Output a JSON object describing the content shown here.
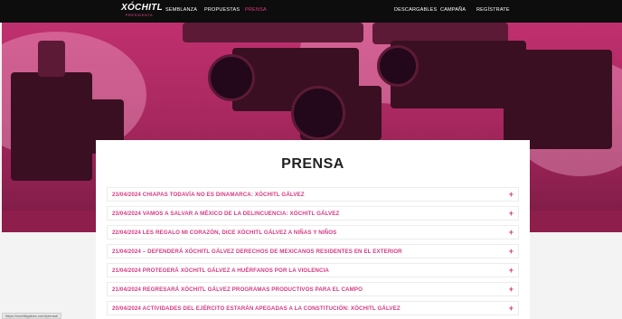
{
  "nav": {
    "logo_main": "XÓCHITL",
    "logo_sub": "PRESIDENTA",
    "left_items": [
      "SEMBLANZA",
      "PROPUESTAS",
      "PRENSA"
    ],
    "right_items": [
      "DESCARGABLES",
      "CAMPAÑA",
      "REGÍSTRATE"
    ],
    "active": "PRENSA"
  },
  "main": {
    "title": "PRENSA",
    "items": [
      "23/04/2024 CHIAPAS TODAVÍA NO ES DINAMARCA: XÓCHITL GÁLVEZ",
      "23/04/2024 VAMOS A SALVAR A MÉXICO DE LA DELINCUENCIA: XÓCHITL GÁLVEZ",
      "22/04/2024 LES REGALO MI CORAZÓN, DICE XÓCHITL GÁLVEZ A NIÑAS Y NIÑOS",
      "21/04/2024 – DEFENDERÁ XÓCHITL GÁLVEZ DERECHOS DE MEXICANOS RESIDENTES EN EL EXTERIOR",
      "21/04/2024 PROTEGERÁ XÓCHITL GÁLVEZ A HUÉRFANOS POR LA VIOLENCIA",
      "21/04/2024 REGRESARÁ XÓCHITL GÁLVEZ PROGRAMAS PRODUCTIVOS PARA EL CAMPO",
      "20/04/2024 ACTIVIDADES DEL EJÉRCITO ESTARÁN APEGADAS A LA CONSTITUCIÓN: XÓCHITL GÁLVEZ"
    ],
    "expand_symbol": "+"
  },
  "status_url": "https://xochitlgalvez.com/prensa/",
  "colors": {
    "accent": "#d63a82",
    "nav_bg": "#0d0d0d",
    "hero": "#b02d66"
  },
  "icons": {
    "expand": "plus-icon"
  }
}
